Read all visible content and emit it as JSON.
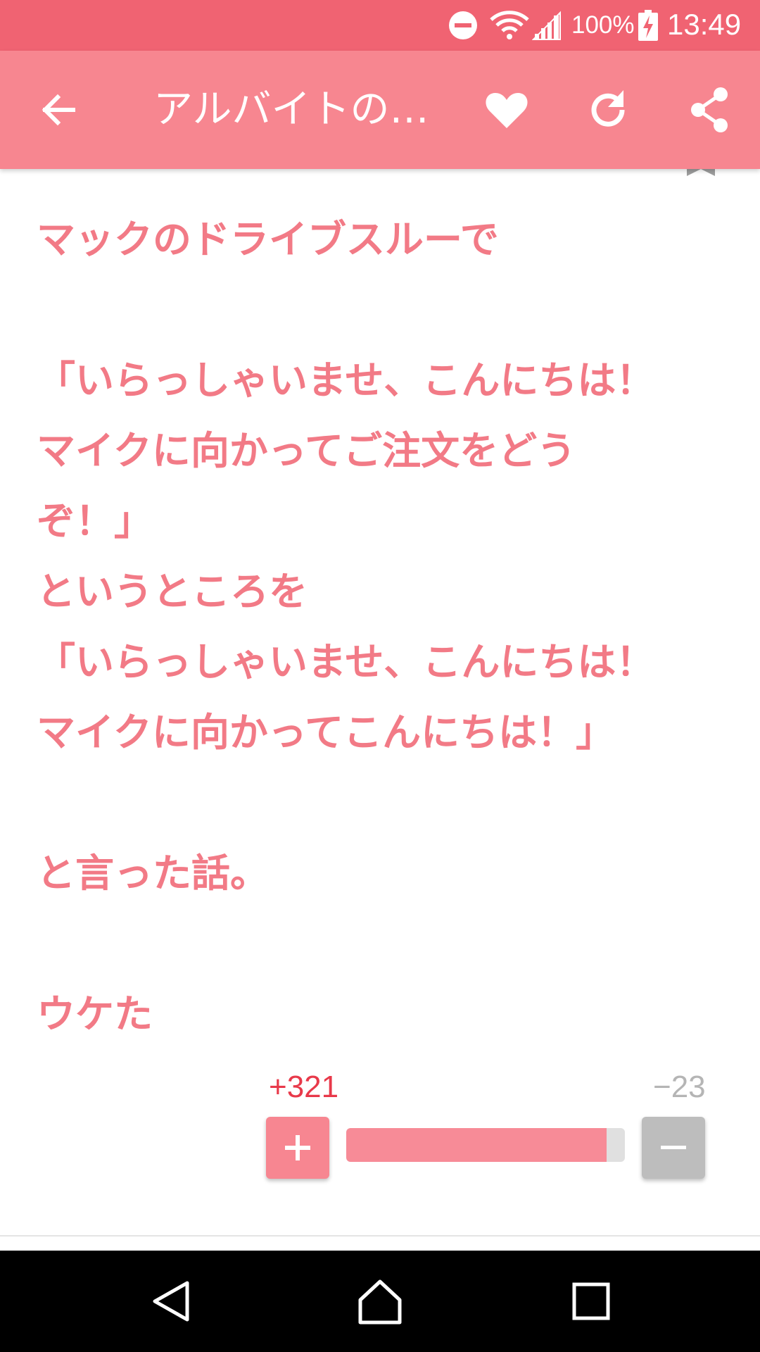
{
  "status_bar": {
    "battery_percent": "100%",
    "time": "13:49",
    "icons": [
      "do-not-disturb-icon",
      "wifi-icon",
      "signal-icon",
      "battery-charging-icon"
    ]
  },
  "app_bar": {
    "title": "アルバイトの…",
    "icons": [
      "back-arrow-icon",
      "heart-icon",
      "refresh-icon",
      "share-icon"
    ]
  },
  "post": {
    "lines": [
      "マックのドライブスルーで",
      "",
      "「いらっしゃいませ、こんにちは！",
      "マイクに向かってご注文をどう",
      "ぞ！」",
      "というところを",
      "「いらっしゃいませ、こんにちは！",
      "マイクに向かってこんにちは！」",
      "",
      "と言った話。",
      "",
      "ウケた"
    ]
  },
  "votes": {
    "up_label": "+321",
    "down_label": "−23",
    "up": 321,
    "down": 23
  },
  "colors": {
    "status_bar": "#f06372",
    "app_bar": "#f78690",
    "text": "#f27a86",
    "up_count": "#e8394a",
    "down_count": "#b5b5b5"
  },
  "nav_bar": {
    "icons": [
      "nav-back-icon",
      "nav-home-icon",
      "nav-recent-apps-icon"
    ]
  }
}
